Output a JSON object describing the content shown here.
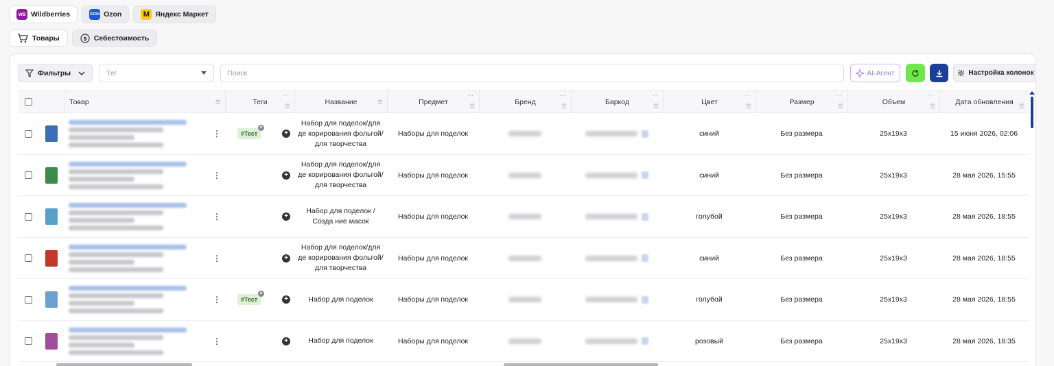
{
  "marketplaces": [
    {
      "label": "Wildberries",
      "logo_text": "WB",
      "color": "#8e1c9c",
      "active": false
    },
    {
      "label": "Ozon",
      "logo_text": "OZON",
      "color": "#1f5bd6",
      "active": true
    },
    {
      "label": "Яндекс Маркет",
      "logo_text": "M",
      "color": "#ffcc00",
      "active": true
    }
  ],
  "sections": [
    {
      "label": "Товары",
      "icon": "cart-icon",
      "active": false
    },
    {
      "label": "Себестоимость",
      "icon": "dollar-circle-icon",
      "active": true
    }
  ],
  "toolbar": {
    "filters_label": "Фильтры",
    "tag_placeholder": "Тег",
    "search_placeholder": "Поиск",
    "ai_label": "AI-Агент",
    "columns_label": "Настройка колонок"
  },
  "table": {
    "headers": {
      "product": "Товар",
      "tags": "Теги",
      "name": "Название",
      "subject": "Предмет",
      "brand": "Бренд",
      "barcode": "Баркод",
      "color": "Цвет",
      "size": "Размер",
      "volume": "Объем",
      "updated": "Дата обновления"
    },
    "rows": [
      {
        "tag": "#Тест",
        "name": "Набор для поделок/для де корирования фольгой/для творчества",
        "subject": "Наборы для поделок",
        "color": "синий",
        "size": "Без размера",
        "volume": "25x19x3",
        "updated": "15 июня 2026, 02:06",
        "thumb": "#3a6fb5"
      },
      {
        "tag": "",
        "name": "Набор для поделок/для де корирования фольгой/для творчества",
        "subject": "Наборы для поделок",
        "color": "синий",
        "size": "Без размера",
        "volume": "25x19x3",
        "updated": "28 мая 2026, 15:55",
        "thumb": "#3e8a4a"
      },
      {
        "tag": "",
        "name": "Набор для поделок / Созда ние масок",
        "subject": "Наборы для поделок",
        "color": "голубой",
        "size": "Без размера",
        "volume": "25x19x3",
        "updated": "28 мая 2026, 18:55",
        "thumb": "#5aa0c8"
      },
      {
        "tag": "",
        "name": "Набор для поделок/для де корирования фольгой/для творчества",
        "subject": "Наборы для поделок",
        "color": "синий",
        "size": "Без размера",
        "volume": "25x19x3",
        "updated": "28 мая 2026, 18:55",
        "thumb": "#c0392b"
      },
      {
        "tag": "#Тест",
        "name": "Набор для поделок",
        "subject": "Наборы для поделок",
        "color": "голубой",
        "size": "Без размера",
        "volume": "25x19x3",
        "updated": "28 мая 2026, 18:55",
        "thumb": "#6ca0d0"
      },
      {
        "tag": "",
        "name": "Набор для поделок",
        "subject": "Наборы для поделок",
        "color": "розовый",
        "size": "Без размера",
        "volume": "25x19x3",
        "updated": "28 мая 2026, 18:35",
        "thumb": "#a04d9c"
      }
    ]
  }
}
